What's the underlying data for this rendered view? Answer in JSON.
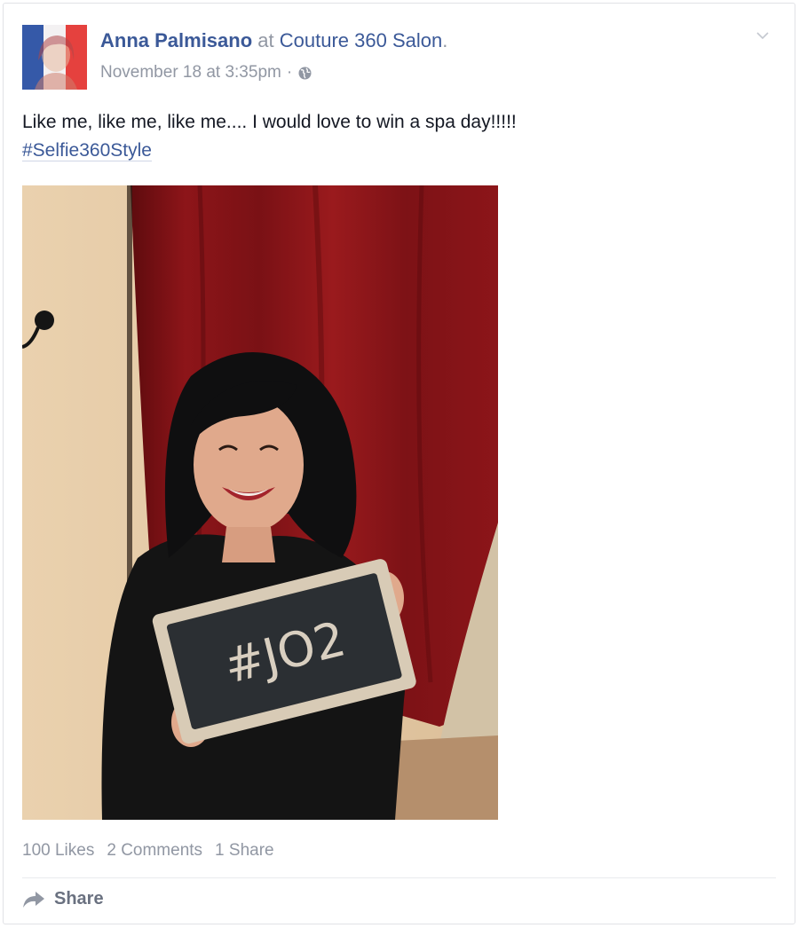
{
  "post": {
    "author": "Anna Palmisano",
    "at_word": "at",
    "place": "Couture 360 Salon",
    "place_suffix": ".",
    "timestamp": "November 18 at 3:35pm",
    "separator": "·",
    "privacy_icon": "globe-icon",
    "text": "Like me, like me, like me.... I would love to win a spa day!!!!!",
    "hashtag": "#Selfie360Style",
    "photo_chalkboard_text": "#JO2"
  },
  "stats": {
    "likes": "100 Likes",
    "comments": "2 Comments",
    "shares": "1 Share"
  },
  "actions": {
    "share_label": "Share",
    "share_icon": "share-arrow-icon",
    "menu_icon": "chevron-down-icon"
  },
  "colors": {
    "link": "#3b5998",
    "meta": "#9197a3",
    "curtain": "#8a1417"
  }
}
